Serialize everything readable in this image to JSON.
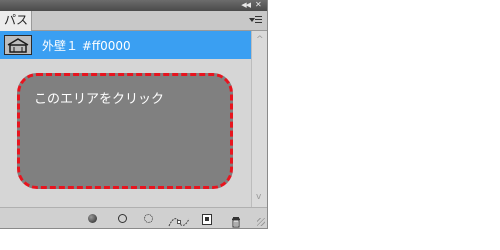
{
  "panel": {
    "tab_label": "パス",
    "collapse_icon": "double-left-arrow-icon",
    "close_icon": "close-icon",
    "menu_icon": "panel-menu-icon"
  },
  "paths": [
    {
      "label": "外壁１ #ff0000",
      "selected": true,
      "thumbnail_icon": "house-outline-icon"
    }
  ],
  "drop_area": {
    "text": "このエリアをクリック",
    "border_color": "#e8141e",
    "fill_color": "#808080"
  },
  "bottom_toolbar": {
    "icons": [
      "fill-path-icon",
      "stroke-path-icon",
      "load-selection-icon",
      "make-work-path-icon",
      "new-path-icon",
      "delete-path-icon"
    ]
  },
  "colors": {
    "selection": "#3a9ff2",
    "panel_bg": "#d6d6d6"
  }
}
